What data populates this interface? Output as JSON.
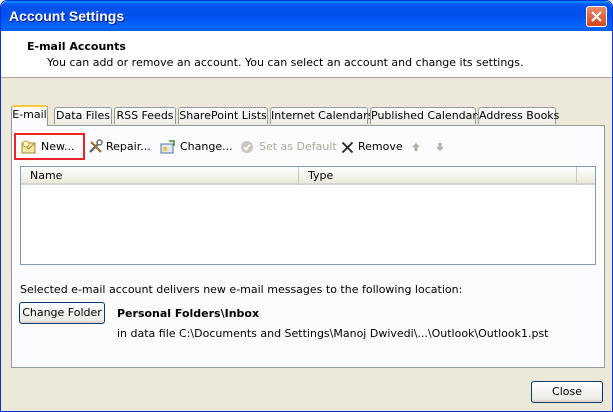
{
  "window": {
    "title": "Account Settings"
  },
  "header": {
    "title": "E-mail Accounts",
    "description": "You can add or remove an account. You can select an account and change its settings."
  },
  "tabs": [
    {
      "label": "E-mail",
      "active": true
    },
    {
      "label": "Data Files"
    },
    {
      "label": "RSS Feeds"
    },
    {
      "label": "SharePoint Lists"
    },
    {
      "label": "Internet Calendars"
    },
    {
      "label": "Published Calendars"
    },
    {
      "label": "Address Books"
    }
  ],
  "toolbar": {
    "new_label": "New...",
    "repair_label": "Repair...",
    "change_label": "Change...",
    "set_default_label": "Set as Default",
    "remove_label": "Remove"
  },
  "list": {
    "columns": [
      "Name",
      "Type"
    ],
    "rows": []
  },
  "delivery": {
    "text": "Selected e-mail account delivers new e-mail messages to the following location:",
    "change_folder_label": "Change Folder",
    "folder_name": "Personal Folders\\Inbox",
    "data_file_path": "in data file C:\\Documents and Settings\\Manoj Dwivedi\\...\\Outlook\\Outlook1.pst"
  },
  "footer": {
    "close_label": "Close"
  }
}
